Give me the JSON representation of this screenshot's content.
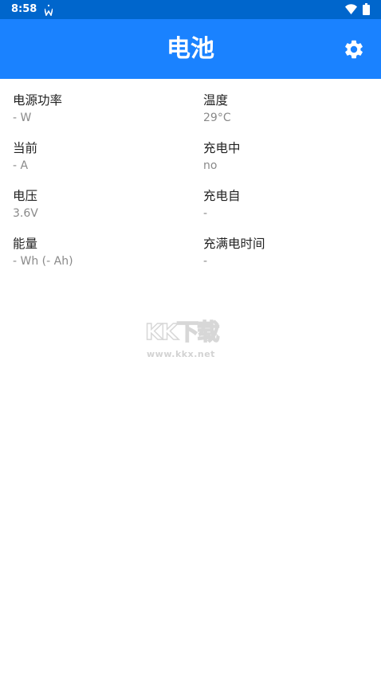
{
  "status_bar": {
    "time": "8:58",
    "notification_icon": "w-notification-icon",
    "wifi_icon": "wifi-icon",
    "battery_icon": "battery-icon"
  },
  "app_bar": {
    "title": "电池",
    "settings_icon": "gear-icon",
    "color": "#1a82ff",
    "status_color": "#0066cc"
  },
  "stats": {
    "power": {
      "label": "电源功率",
      "value": "- W"
    },
    "temperature": {
      "label": "温度",
      "value": "29°C"
    },
    "current": {
      "label": "当前",
      "value": "- A"
    },
    "charging": {
      "label": "充电中",
      "value": "no"
    },
    "voltage": {
      "label": "电压",
      "value": "3.6V"
    },
    "charging_since": {
      "label": "充电自",
      "value": "-"
    },
    "energy": {
      "label": "能量",
      "value": "- Wh (- Ah)"
    },
    "time_to_full": {
      "label": "充满电时间",
      "value": "-"
    }
  },
  "watermark": {
    "logo": "KK下载",
    "url": "www.kkx.net"
  }
}
